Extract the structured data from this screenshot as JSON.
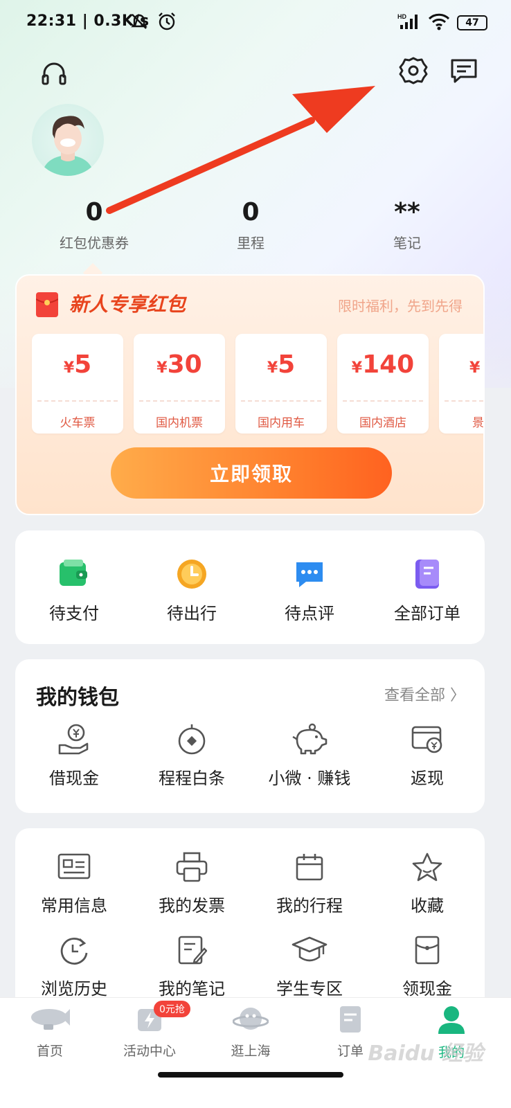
{
  "status_bar": {
    "time": "22:31 | 0.3K/s",
    "network": "HD",
    "battery": "47"
  },
  "header": {
    "support_icon": "headset-icon",
    "settings_icon": "gear-icon",
    "message_icon": "message-icon"
  },
  "stats": [
    {
      "value": "0",
      "label": "红包优惠券"
    },
    {
      "value": "0",
      "label": "里程"
    },
    {
      "value": "**",
      "label": "笔记"
    }
  ],
  "red_packet": {
    "title": "新人专享红包",
    "subtitle": "限时福利，先到先得",
    "currency": "¥",
    "coupons": [
      {
        "amount": "5",
        "label": "火车票"
      },
      {
        "amount": "30",
        "label": "国内机票"
      },
      {
        "amount": "5",
        "label": "国内用车"
      },
      {
        "amount": "140",
        "label": "国内酒店"
      },
      {
        "amount": "",
        "label": "景"
      }
    ],
    "claim_label": "立即领取"
  },
  "orders": [
    {
      "label": "待支付",
      "icon": "wallet-icon",
      "color": "#27c06b"
    },
    {
      "label": "待出行",
      "icon": "clock-icon",
      "color": "#f5a623"
    },
    {
      "label": "待点评",
      "icon": "comment-icon",
      "color": "#2d8cf0"
    },
    {
      "label": "全部订单",
      "icon": "document-icon",
      "color": "#7b5cf0"
    }
  ],
  "wallet": {
    "title": "我的钱包",
    "more": "查看全部 〉",
    "items": [
      {
        "label": "借现金",
        "icon": "cash-hand-icon"
      },
      {
        "label": "程程白条",
        "icon": "credit-icon"
      },
      {
        "label": "小微 · 赚钱",
        "icon": "piggy-bank-icon"
      },
      {
        "label": "返现",
        "icon": "cashback-card-icon"
      }
    ]
  },
  "services": {
    "items": [
      {
        "label": "常用信息",
        "icon": "id-card-icon"
      },
      {
        "label": "我的发票",
        "icon": "printer-icon"
      },
      {
        "label": "我的行程",
        "icon": "calendar-icon"
      },
      {
        "label": "收藏",
        "icon": "star-icon"
      },
      {
        "label": "浏览历史",
        "icon": "history-icon"
      },
      {
        "label": "我的笔记",
        "icon": "note-edit-icon"
      },
      {
        "label": "学生专区",
        "icon": "graduation-cap-icon"
      },
      {
        "label": "领现金",
        "icon": "envelope-icon"
      }
    ]
  },
  "tab_bar": {
    "items": [
      {
        "label": "首页",
        "icon": "home-blimp-icon"
      },
      {
        "label": "活动中心",
        "icon": "activity-icon",
        "badge": "0元抢"
      },
      {
        "label": "逛上海",
        "icon": "planet-icon"
      },
      {
        "label": "订单",
        "icon": "order-icon"
      },
      {
        "label": "我的",
        "icon": "profile-icon"
      }
    ]
  },
  "watermark": "Baidu 经验",
  "colors": {
    "accent": "#19b67f",
    "red": "#f2433a",
    "orange": "#ff7a2a"
  }
}
